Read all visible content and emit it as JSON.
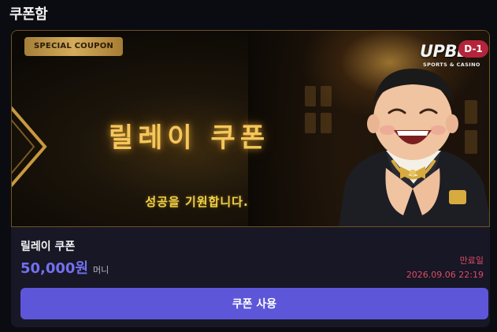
{
  "page": {
    "title": "쿠폰함"
  },
  "coupon": {
    "banner": {
      "tag": "SPECIAL COUPON",
      "title": "릴레이 쿠폰",
      "subtitle": "성공을 기원합니다.",
      "logo_text": "UPBET",
      "logo_subtext": "SPORTS & CASINO",
      "dday_badge": "D-1"
    },
    "name": "릴레이 쿠폰",
    "amount": "50,000원",
    "unit": "머니",
    "expire_label": "만료일",
    "expire_date": "2026.09.06 22:19",
    "use_button_label": "쿠폰 사용"
  },
  "colors": {
    "accent": "#5d56d9",
    "amount": "#7370ee",
    "expire": "#e04b62",
    "badge": "#b4243a",
    "gold": "#f5c65a"
  }
}
